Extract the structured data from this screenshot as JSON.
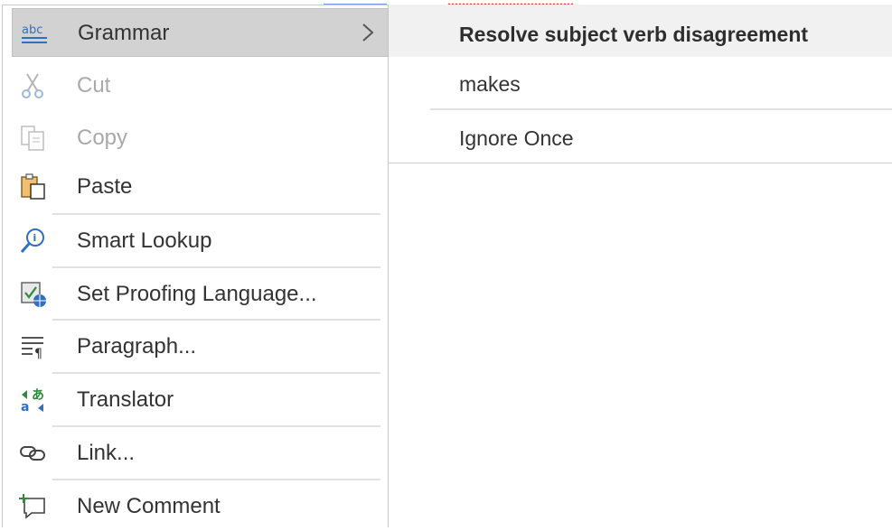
{
  "menu": {
    "items": [
      {
        "label": "Grammar",
        "icon": "grammar-abc-icon",
        "state": "highlighted",
        "has_submenu": true
      },
      {
        "label": "Cut",
        "icon": "scissors-icon",
        "state": "disabled"
      },
      {
        "label": "Copy",
        "icon": "copy-icon",
        "state": "disabled"
      },
      {
        "label": "Paste",
        "icon": "clipboard-icon",
        "state": "enabled"
      },
      {
        "label": "Smart Lookup",
        "icon": "smart-lookup-icon",
        "state": "enabled"
      },
      {
        "label": "Set Proofing Language...",
        "icon": "proofing-language-icon",
        "state": "enabled"
      },
      {
        "label": "Paragraph...",
        "icon": "paragraph-icon",
        "state": "enabled"
      },
      {
        "label": "Translator",
        "icon": "translator-icon",
        "state": "enabled"
      },
      {
        "label": "Link...",
        "icon": "link-icon",
        "state": "enabled"
      },
      {
        "label": "New Comment",
        "icon": "new-comment-icon",
        "state": "enabled"
      }
    ]
  },
  "submenu": {
    "header": "Resolve subject verb disagreement",
    "suggestion": "makes",
    "ignore": "Ignore Once"
  },
  "colors": {
    "highlight": "#d2d2d2",
    "submenu_header_bg": "#f1f1f1",
    "accent_blue": "#2f6fc0",
    "proofing_red": "#e23a3a"
  }
}
